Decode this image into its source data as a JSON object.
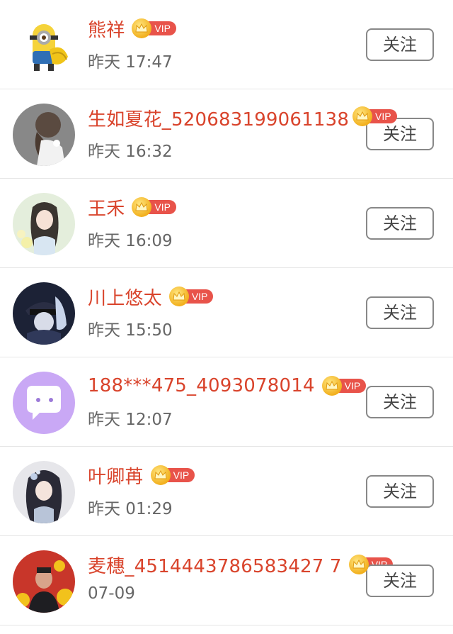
{
  "follow_label": "关注",
  "vip_label": "VIP",
  "users": [
    {
      "name": "熊祥",
      "time": "昨天 17:47",
      "avatar": "minion-avatar"
    },
    {
      "name": "生如夏花_520683199061138",
      "time": "昨天 16:32",
      "avatar": "girl-back-avatar"
    },
    {
      "name": "王禾",
      "time": "昨天 16:09",
      "avatar": "anime-girl-avatar"
    },
    {
      "name": "川上悠太",
      "time": "昨天 15:50",
      "avatar": "anime-boy-avatar"
    },
    {
      "name": "188***475_4093078014",
      "time": "昨天 12:07",
      "avatar": "default-chat-avatar"
    },
    {
      "name": "叶卿苒",
      "time": "昨天 01:29",
      "avatar": "anime-lady-avatar"
    },
    {
      "name": "麦穗_4514443786583427 7",
      "time": "07-09",
      "avatar": "photo-avatar"
    }
  ],
  "colors": {
    "name": "#d9442c",
    "vip_tag": "#e8534a",
    "crown": "#f2b01e",
    "time": "#666666",
    "button_border": "#888888"
  }
}
